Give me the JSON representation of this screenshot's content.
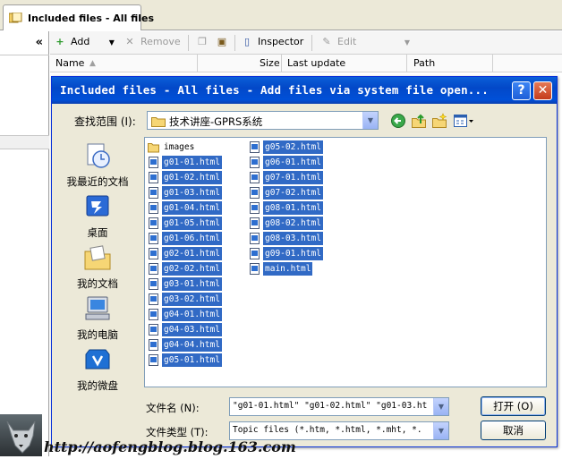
{
  "app": {
    "tab_title": "Included files - All files",
    "collapse_glyph": "«",
    "toolbar": {
      "add": "Add",
      "remove": "Remove",
      "inspector": "Inspector",
      "edit": "Edit"
    },
    "columns": [
      "Name",
      "Size",
      "Last update",
      "Path"
    ]
  },
  "dialog": {
    "title": "Included files - All files - Add files via system file open...",
    "help_glyph": "?",
    "close_glyph": "✕",
    "look_in_label": "查找范围 (I):",
    "look_in_value": "技术讲座-GPRS系统",
    "places": [
      {
        "label": "我最近的文档",
        "icon": "recent-documents-icon"
      },
      {
        "label": "桌面",
        "icon": "desktop-icon"
      },
      {
        "label": "我的文档",
        "icon": "my-documents-icon"
      },
      {
        "label": "我的电脑",
        "icon": "my-computer-icon"
      },
      {
        "label": "我的微盘",
        "icon": "my-netdisk-icon"
      }
    ],
    "files_col1": [
      {
        "name": "images",
        "type": "folder",
        "selected": false
      },
      {
        "name": "g01-01.html",
        "type": "file",
        "selected": true
      },
      {
        "name": "g01-02.html",
        "type": "file",
        "selected": true
      },
      {
        "name": "g01-03.html",
        "type": "file",
        "selected": true
      },
      {
        "name": "g01-04.html",
        "type": "file",
        "selected": true
      },
      {
        "name": "g01-05.html",
        "type": "file",
        "selected": true
      },
      {
        "name": "g01-06.html",
        "type": "file",
        "selected": true
      },
      {
        "name": "g02-01.html",
        "type": "file",
        "selected": true
      },
      {
        "name": "g02-02.html",
        "type": "file",
        "selected": true
      },
      {
        "name": "g03-01.html",
        "type": "file",
        "selected": true
      },
      {
        "name": "g03-02.html",
        "type": "file",
        "selected": true
      },
      {
        "name": "g04-01.html",
        "type": "file",
        "selected": true
      },
      {
        "name": "g04-03.html",
        "type": "file",
        "selected": true
      },
      {
        "name": "g04-04.html",
        "type": "file",
        "selected": true
      },
      {
        "name": "g05-01.html",
        "type": "file",
        "selected": true
      }
    ],
    "files_col2": [
      {
        "name": "g05-02.html",
        "type": "file",
        "selected": true
      },
      {
        "name": "g06-01.html",
        "type": "file",
        "selected": true
      },
      {
        "name": "g07-01.html",
        "type": "file",
        "selected": true
      },
      {
        "name": "g07-02.html",
        "type": "file",
        "selected": true
      },
      {
        "name": "g08-01.html",
        "type": "file",
        "selected": true
      },
      {
        "name": "g08-02.html",
        "type": "file",
        "selected": true
      },
      {
        "name": "g08-03.html",
        "type": "file",
        "selected": true
      },
      {
        "name": "g09-01.html",
        "type": "file",
        "selected": true
      },
      {
        "name": "main.html",
        "type": "file",
        "selected": true
      }
    ],
    "filename_label": "文件名 (N):",
    "filename_value": "\"g01-01.html\" \"g01-02.html\" \"g01-03.ht",
    "filetype_label": "文件类型 (T):",
    "filetype_value": "Topic files (*.htm, *.html, *.mht, *.",
    "open_button": "打开 (O)",
    "cancel_button": "取消"
  },
  "watermark": "http://aofengblog.blog.163.com",
  "colors": {
    "title_blue": "#0348c8",
    "selection": "#316ac5",
    "dialog_bg": "#ece9d8"
  }
}
